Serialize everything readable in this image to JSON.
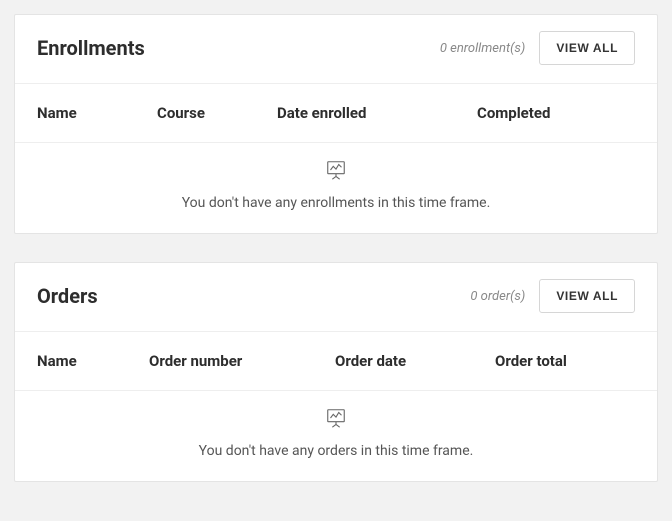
{
  "enrollments": {
    "title": "Enrollments",
    "count_text": "0 enrollment(s)",
    "view_all_label": "VIEW ALL",
    "columns": {
      "name": "Name",
      "course": "Course",
      "date_enrolled": "Date enrolled",
      "completed": "Completed"
    },
    "empty_message": "You don't have any enrollments in this time frame."
  },
  "orders": {
    "title": "Orders",
    "count_text": "0 order(s)",
    "view_all_label": "VIEW ALL",
    "columns": {
      "name": "Name",
      "order_number": "Order number",
      "order_date": "Order date",
      "order_total": "Order total"
    },
    "empty_message": "You don't have any orders in this time frame."
  }
}
